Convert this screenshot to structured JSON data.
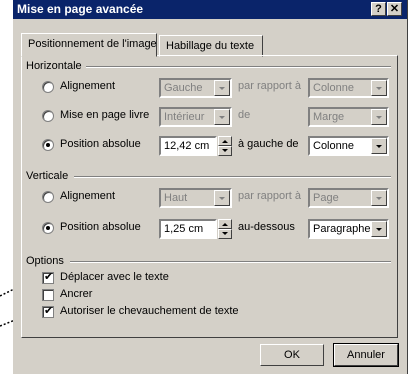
{
  "window": {
    "title": "Mise en page avancée",
    "help_button": "?",
    "close_button": "✕"
  },
  "tabs": [
    {
      "label": "Positionnement de l'image",
      "active": true
    },
    {
      "label": "Habillage du texte",
      "active": false
    }
  ],
  "horizontal": {
    "group_label": "Horizontale",
    "rows": [
      {
        "option": "Alignement",
        "selected": false,
        "value": "Gauche",
        "relation": "par rapport à",
        "reference": "Colonne",
        "enabled": false
      },
      {
        "option": "Mise en page livre",
        "selected": false,
        "value": "Intérieur",
        "relation": "de",
        "reference": "Marge",
        "enabled": false
      },
      {
        "option": "Position absolue",
        "selected": true,
        "value": "12,42 cm",
        "relation": "à gauche de",
        "reference": "Colonne",
        "enabled": true
      }
    ]
  },
  "vertical": {
    "group_label": "Verticale",
    "rows": [
      {
        "option": "Alignement",
        "selected": false,
        "value": "Haut",
        "relation": "par rapport à",
        "reference": "Page",
        "enabled": false
      },
      {
        "option": "Position absolue",
        "selected": true,
        "value": "1,25 cm",
        "relation": "au-dessous",
        "reference": "Paragraphe",
        "enabled": true
      }
    ]
  },
  "options": {
    "group_label": "Options",
    "items": [
      {
        "label": "Déplacer avec le texte",
        "checked": true
      },
      {
        "label": "Ancrer",
        "checked": false
      },
      {
        "label": "Autoriser le chevauchement de texte",
        "checked": true
      }
    ]
  },
  "buttons": {
    "ok": "OK",
    "cancel": "Annuler"
  },
  "colors": {
    "title_bar": "#0a246a",
    "dialog_bg": "#d4d0c8",
    "disabled_text": "#808080"
  }
}
